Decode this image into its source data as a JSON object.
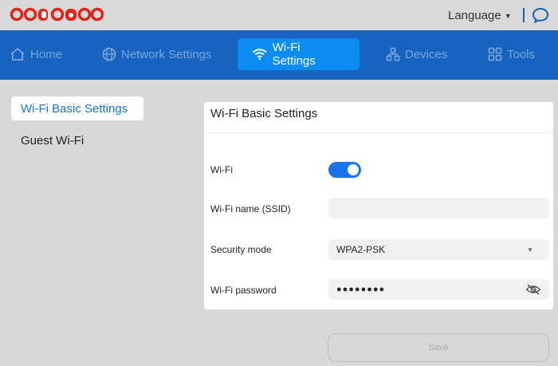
{
  "header": {
    "logo_text": "ooredoo",
    "language_label": "Language"
  },
  "nav": {
    "items": [
      {
        "label": "Home",
        "icon": "home-icon"
      },
      {
        "label": "Network Settings",
        "icon": "globe-icon"
      },
      {
        "label": "Wi-Fi Settings",
        "icon": "wifi-icon",
        "active": true
      },
      {
        "label": "Devices",
        "icon": "devices-icon"
      },
      {
        "label": "Tools",
        "icon": "tools-icon"
      }
    ]
  },
  "sidebar": {
    "items": [
      {
        "label": "Wi-Fi Basic Settings",
        "active": true
      },
      {
        "label": "Guest Wi-Fi"
      }
    ]
  },
  "panel": {
    "title": "Wi-Fi Basic Settings",
    "wifi_label": "Wi-Fi",
    "wifi_enabled": true,
    "ssid_label": "Wi-Fi name (SSID)",
    "ssid_value": "",
    "security_label": "Security mode",
    "security_value": "WPA2-PSK",
    "password_label": "Wi-Fi password",
    "password_value": "●●●●●●●●"
  },
  "actions": {
    "save_label": "Save"
  },
  "colors": {
    "nav_bg": "#1664c0",
    "nav_active": "#0a8cf2",
    "brand_red": "#e2231a",
    "toggle_on": "#1a73e8"
  }
}
